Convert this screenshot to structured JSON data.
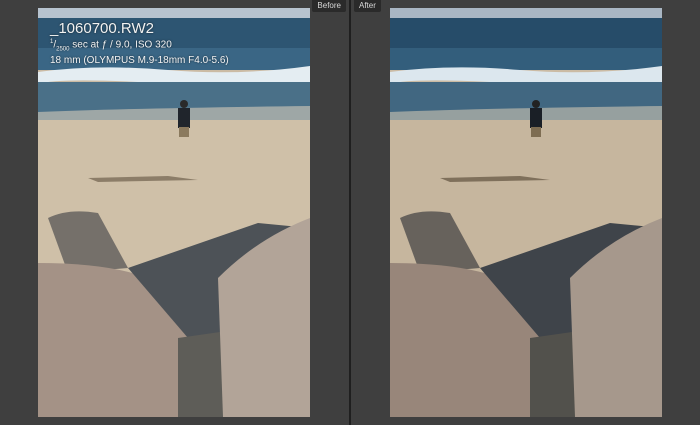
{
  "compare": {
    "before_label": "Before",
    "after_label": "After"
  },
  "info_overlay": {
    "filename": "_1060700.RW2",
    "shutter_num": "1",
    "shutter_den": "2500",
    "exposure_rest": " sec at ƒ / 9.0, ISO 320",
    "lens": "18 mm (OLYMPUS M.9-18mm F4.0-5.6)"
  },
  "colors": {
    "app_background": "#3f3f3f",
    "label_background": "#2a2a2a",
    "label_text": "#d8d8d8"
  }
}
